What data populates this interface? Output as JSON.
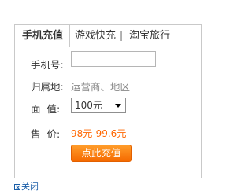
{
  "tabs": [
    {
      "label": "手机充值",
      "active": true
    },
    {
      "label": "游戏快充",
      "active": false
    },
    {
      "label": "淘宝旅行",
      "active": false
    }
  ],
  "tab_separator": "|",
  "form": {
    "phone_label": "手机号:",
    "phone_value": "",
    "area_label": "归属地:",
    "area_value": "运营商、地区",
    "face_value_label": "面  值:",
    "face_value_selected": "100元",
    "price_label": "售  价:",
    "price_value": "98元-99.6元",
    "submit_label": "点此充值"
  },
  "footer": {
    "close_label": "关闭"
  },
  "colors": {
    "accent": "#ff6600",
    "button": "#f57d00",
    "link": "#1a5ea8",
    "border": "#c9c9c9"
  }
}
